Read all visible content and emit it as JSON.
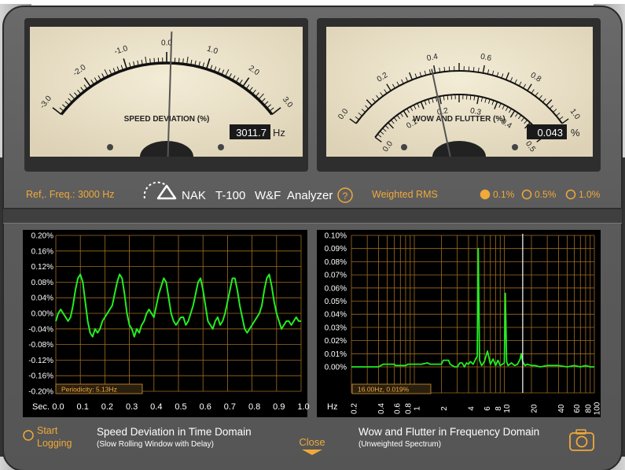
{
  "colors": {
    "accent": "#f0a93a",
    "trace": "#22ee22",
    "meter_face": "#ede4cd",
    "grid": "#b07a2a",
    "panel": "#5a5a5a",
    "plot_bg": "#000000"
  },
  "meters": {
    "speed": {
      "ticks": [
        "-3.0",
        "-2.0",
        "-1.0",
        "0.0",
        "1.0",
        "2.0",
        "3.0"
      ],
      "title": "SPEED DEVIATION (%)",
      "value": "3011.7",
      "unit": "Hz",
      "needle": 0.1
    },
    "wow": {
      "outer_ticks": [
        "0.0",
        "0.2",
        "0.4",
        "0.6",
        "0.8",
        "1.0"
      ],
      "inner_ticks": [
        "0.0",
        "0.1",
        "0.2",
        "0.3",
        "0.4",
        "0.5"
      ],
      "title": "WOW AND FLUTTER (%)",
      "value": "0.043",
      "unit": "%",
      "needle": 0.043
    }
  },
  "controls": {
    "ref_freq": "Ref,. Freq.: 3000 Hz",
    "brand": [
      "NAK",
      "T-100",
      "W&F",
      "Analyzer"
    ],
    "help": "?",
    "weighting": "Weighted RMS",
    "range_options": [
      {
        "label": "0.1%",
        "selected": true
      },
      {
        "label": "0.5%",
        "selected": false
      },
      {
        "label": "1.0%",
        "selected": false
      }
    ]
  },
  "left_plot": {
    "y_ticks": [
      "0.20%",
      "0.16%",
      "0.12%",
      "0.08%",
      "0.04%",
      "0.00%",
      "-0.04%",
      "-0.08%",
      "-0.12%",
      "-0.16%",
      "-0.20%"
    ],
    "x_unit": "Sec.",
    "x_ticks": [
      "0.0",
      "0.1",
      "0.2",
      "0.3",
      "0.4",
      "0.5",
      "0.6",
      "0.7",
      "0.8",
      "0.9",
      "1.0"
    ],
    "readout": "Periodicity:  5.13Hz",
    "caption_title": "Speed Deviation in Time Domain",
    "caption_sub": "(Slow Rolling Window with Delay)"
  },
  "right_plot": {
    "y_ticks": [
      "0.10%",
      "0.09%",
      "0.08%",
      "0.07%",
      "0.06%",
      "0.05%",
      "0.04%",
      "0.03%",
      "0.02%",
      "0.01%",
      "0.00%"
    ],
    "x_unit": "Hz",
    "x_ticks": [
      "0.2",
      "0.4",
      "0.6",
      "0.8",
      "1",
      "2",
      "4",
      "6",
      "8",
      "10",
      "20",
      "40",
      "60",
      "80",
      "100"
    ],
    "readout": "16.00Hz,    0.019%",
    "caption_title": "Wow and Flutter in Frequency Domain",
    "caption_sub": "(Unweighted Spectrum)"
  },
  "bottom": {
    "start_logging": [
      "Start",
      "Logging"
    ],
    "close": "Close"
  },
  "chart_data": [
    {
      "type": "line",
      "title": "",
      "xlabel": "Sec.",
      "ylabel": "",
      "xlim": [
        0,
        1.0
      ],
      "ylim": [
        -0.2,
        0.2
      ],
      "grid": true,
      "series": [
        {
          "x": [
            0.0,
            0.01,
            0.02,
            0.03,
            0.04,
            0.05,
            0.06,
            0.07,
            0.08,
            0.09,
            0.1,
            0.11,
            0.12,
            0.13,
            0.14,
            0.15,
            0.16,
            0.17,
            0.18,
            0.19,
            0.2,
            0.21,
            0.22,
            0.23,
            0.24,
            0.25,
            0.26,
            0.27,
            0.28,
            0.29,
            0.3,
            0.31,
            0.32,
            0.33,
            0.34,
            0.35,
            0.36,
            0.37,
            0.38,
            0.39,
            0.4,
            0.41,
            0.42,
            0.43,
            0.44,
            0.45,
            0.46,
            0.47,
            0.48,
            0.49,
            0.5,
            0.51,
            0.52,
            0.53,
            0.54,
            0.55,
            0.56,
            0.57,
            0.58,
            0.59,
            0.6,
            0.61,
            0.62,
            0.63,
            0.64,
            0.65,
            0.66,
            0.67,
            0.68,
            0.69,
            0.7,
            0.71,
            0.72,
            0.73,
            0.74,
            0.75,
            0.76,
            0.77,
            0.78,
            0.79,
            0.8,
            0.81,
            0.82,
            0.83,
            0.84,
            0.85,
            0.86,
            0.87,
            0.88,
            0.89,
            0.9,
            0.91,
            0.92,
            0.93,
            0.94,
            0.95,
            0.96,
            0.97,
            0.98,
            0.99,
            1.0
          ],
          "values": [
            -0.02,
            0.0,
            0.01,
            0.0,
            -0.01,
            -0.02,
            -0.01,
            0.02,
            0.06,
            0.09,
            0.1,
            0.08,
            0.03,
            -0.02,
            -0.05,
            -0.06,
            -0.04,
            -0.05,
            -0.04,
            -0.02,
            -0.01,
            0.0,
            0.01,
            0.02,
            0.05,
            0.08,
            0.1,
            0.09,
            0.05,
            0.0,
            -0.03,
            -0.04,
            -0.06,
            -0.04,
            -0.05,
            -0.03,
            -0.02,
            0.0,
            0.01,
            0.0,
            -0.01,
            0.02,
            0.05,
            0.07,
            0.09,
            0.08,
            0.04,
            0.0,
            -0.02,
            -0.03,
            -0.02,
            -0.01,
            -0.01,
            -0.03,
            -0.02,
            0.0,
            0.02,
            0.05,
            0.08,
            0.09,
            0.06,
            0.02,
            -0.02,
            -0.03,
            -0.04,
            -0.02,
            -0.01,
            -0.03,
            -0.02,
            0.0,
            0.03,
            0.06,
            0.09,
            0.09,
            0.06,
            0.02,
            -0.01,
            -0.04,
            -0.05,
            -0.04,
            -0.03,
            -0.02,
            -0.01,
            0.0,
            0.02,
            0.06,
            0.09,
            0.1,
            0.07,
            0.03,
            0.0,
            -0.02,
            -0.04,
            -0.03,
            -0.02,
            -0.02,
            -0.03,
            -0.02,
            -0.01,
            -0.02,
            -0.02
          ]
        }
      ]
    },
    {
      "type": "line",
      "title": "",
      "xlabel": "Hz",
      "ylabel": "",
      "xlim": [
        0.2,
        100
      ],
      "ylim": [
        0,
        0.1
      ],
      "xscale": "log",
      "grid": true,
      "series": [
        {
          "x": [
            0.2,
            0.4,
            0.45,
            0.6,
            0.62,
            0.8,
            0.85,
            1.1,
            1.2,
            1.4,
            1.5,
            1.6,
            2.0,
            2.1,
            2.4,
            2.5,
            2.8,
            3.0,
            3.2,
            3.4,
            3.6,
            3.8,
            4.0,
            4.2,
            4.5,
            4.8,
            5.0,
            5.13,
            5.3,
            5.6,
            6.0,
            6.5,
            7.0,
            7.5,
            8.0,
            8.5,
            9.0,
            9.5,
            10.0,
            10.26,
            10.6,
            11.0,
            12.0,
            13.0,
            14.0,
            15.0,
            15.4,
            16.0,
            17.0,
            18.0,
            20.0,
            22.0,
            25.0,
            30.0,
            35.0,
            40.0,
            50.0,
            60.0,
            70.0,
            80.0,
            90.0,
            100.0
          ],
          "values": [
            0.0,
            0.0,
            0.002,
            0.002,
            0.001,
            0.001,
            0.002,
            0.002,
            0.002,
            0.003,
            0.002,
            0.002,
            0.002,
            0.005,
            0.005,
            0.002,
            0.0,
            0.0,
            0.003,
            0.003,
            0.0,
            0.003,
            0.002,
            0.004,
            0.002,
            0.006,
            0.008,
            0.09,
            0.005,
            0.001,
            0.004,
            0.012,
            0.002,
            0.006,
            0.001,
            0.005,
            0.001,
            0.002,
            0.003,
            0.056,
            0.004,
            0.001,
            0.003,
            0.001,
            0.002,
            0.006,
            0.01,
            0.004,
            0.001,
            0.002,
            0.001,
            0.001,
            0.0,
            0.001,
            0.001,
            0.001,
            0.0,
            0.001,
            0.0,
            0.001,
            0.0,
            0.0
          ]
        }
      ]
    }
  ]
}
